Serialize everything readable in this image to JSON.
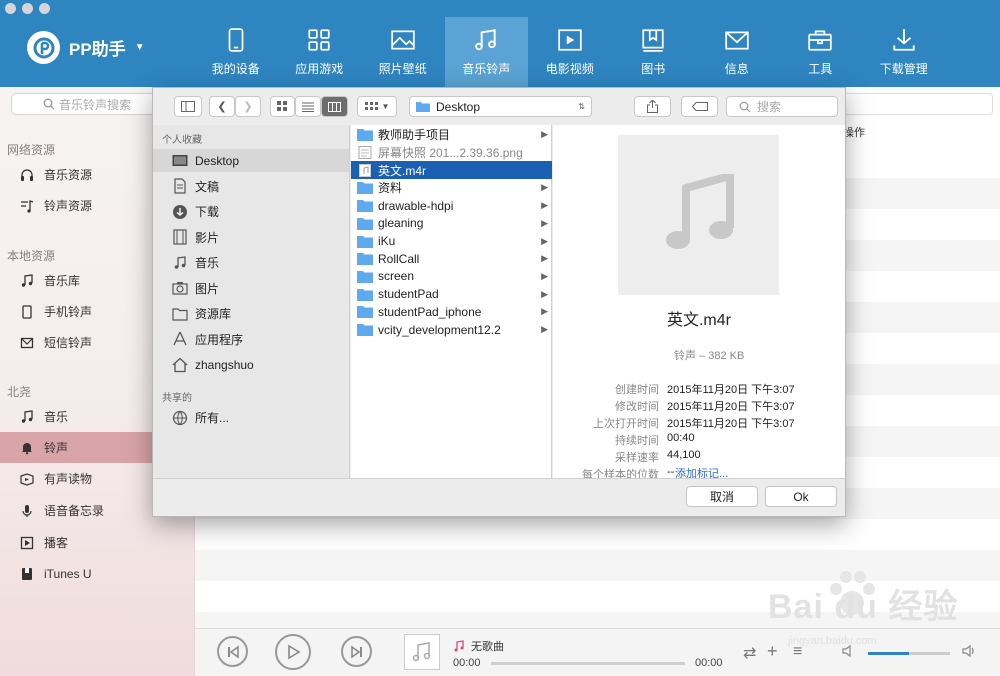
{
  "app": {
    "name": "PP助手",
    "logo_letter": "P",
    "brand_color": "#2f85c0"
  },
  "nav": [
    {
      "label": "我的设备",
      "icon": "phone-icon"
    },
    {
      "label": "应用游戏",
      "icon": "apps-grid-icon"
    },
    {
      "label": "照片壁纸",
      "icon": "image-icon"
    },
    {
      "label": "音乐铃声",
      "icon": "music-note-icon",
      "active": true
    },
    {
      "label": "电影视频",
      "icon": "video-play-icon"
    },
    {
      "label": "图书",
      "icon": "book-icon"
    },
    {
      "label": "信息",
      "icon": "mail-icon"
    },
    {
      "label": "工具",
      "icon": "toolbox-icon"
    },
    {
      "label": "下载管理",
      "icon": "download-icon"
    }
  ],
  "sidebar": {
    "search_placeholder": "音乐铃声搜索",
    "sections": [
      {
        "title": "网络资源",
        "items": [
          {
            "label": "音乐资源",
            "icon": "headphones-icon"
          },
          {
            "label": "铃声资源",
            "icon": "ringtone-icon"
          }
        ]
      },
      {
        "title": "本地资源",
        "items": [
          {
            "label": "音乐库",
            "icon": "music-note-icon"
          },
          {
            "label": "手机铃声",
            "icon": "phone-icon"
          },
          {
            "label": "短信铃声",
            "icon": "message-icon"
          }
        ]
      },
      {
        "title": "北尧",
        "items": [
          {
            "label": "音乐",
            "icon": "music-note-icon"
          },
          {
            "label": "铃声",
            "icon": "bell-icon",
            "active": true
          },
          {
            "label": "有声读物",
            "icon": "audiobook-icon"
          },
          {
            "label": "语音备忘录",
            "icon": "microphone-icon"
          },
          {
            "label": "播客",
            "icon": "podcast-icon"
          },
          {
            "label": "iTunes U",
            "icon": "itunes-u-icon"
          }
        ]
      }
    ]
  },
  "main": {
    "column_header": "操作"
  },
  "dialog": {
    "location": "Desktop",
    "search_placeholder": "搜索",
    "favorites_title": "个人收藏",
    "favorites": [
      {
        "label": "Desktop",
        "icon": "desktop-icon",
        "selected": true
      },
      {
        "label": "文稿",
        "icon": "document-icon"
      },
      {
        "label": "下载",
        "icon": "download-icon"
      },
      {
        "label": "影片",
        "icon": "film-icon"
      },
      {
        "label": "音乐",
        "icon": "music-note-icon"
      },
      {
        "label": "图片",
        "icon": "camera-icon"
      },
      {
        "label": "资源库",
        "icon": "folder-icon"
      },
      {
        "label": "应用程序",
        "icon": "applications-icon"
      },
      {
        "label": "zhangshuo",
        "icon": "home-icon"
      }
    ],
    "shared_title": "共享的",
    "shared": [
      {
        "label": "所有...",
        "icon": "network-icon"
      }
    ],
    "files": [
      {
        "name": "教师助手项目",
        "type": "folder",
        "has_children": true
      },
      {
        "name": "屏幕快照 201...2.39.36.png",
        "type": "image",
        "dimmed": true
      },
      {
        "name": "英文.m4r",
        "type": "audio",
        "selected": true
      },
      {
        "name": "资料",
        "type": "folder",
        "has_children": true
      },
      {
        "name": "drawable-hdpi",
        "type": "folder",
        "has_children": true
      },
      {
        "name": "gleaning",
        "type": "folder",
        "has_children": true
      },
      {
        "name": "iKu",
        "type": "folder",
        "has_children": true
      },
      {
        "name": "RollCall",
        "type": "folder",
        "has_children": true
      },
      {
        "name": "screen",
        "type": "folder",
        "has_children": true
      },
      {
        "name": "studentPad",
        "type": "folder",
        "has_children": true
      },
      {
        "name": "studentPad_iphone",
        "type": "folder",
        "has_children": true
      },
      {
        "name": "vcity_development12.2",
        "type": "folder",
        "has_children": true
      }
    ],
    "preview": {
      "name": "英文.m4r",
      "kind": "铃声 – 382 KB",
      "details": [
        {
          "key": "创建时间",
          "value": "2015年11月20日 下午3:07"
        },
        {
          "key": "修改时间",
          "value": "2015年11月20日 下午3:07"
        },
        {
          "key": "上次打开时间",
          "value": "2015年11月20日 下午3:07"
        },
        {
          "key": "持续时间",
          "value": "00:40"
        },
        {
          "key": "采样速率",
          "value": "44,100"
        },
        {
          "key": "每个样本的位数",
          "value": "--"
        }
      ],
      "add_tags_link": "添加标记..."
    },
    "cancel_label": "取消",
    "ok_label": "Ok"
  },
  "player": {
    "song_title": "无歌曲",
    "elapsed": "00:00",
    "total": "00:00",
    "progress": 0,
    "volume": 0.5
  },
  "watermark": {
    "main": "Bai du 经验",
    "sub": "jingyan.baidu.com"
  }
}
